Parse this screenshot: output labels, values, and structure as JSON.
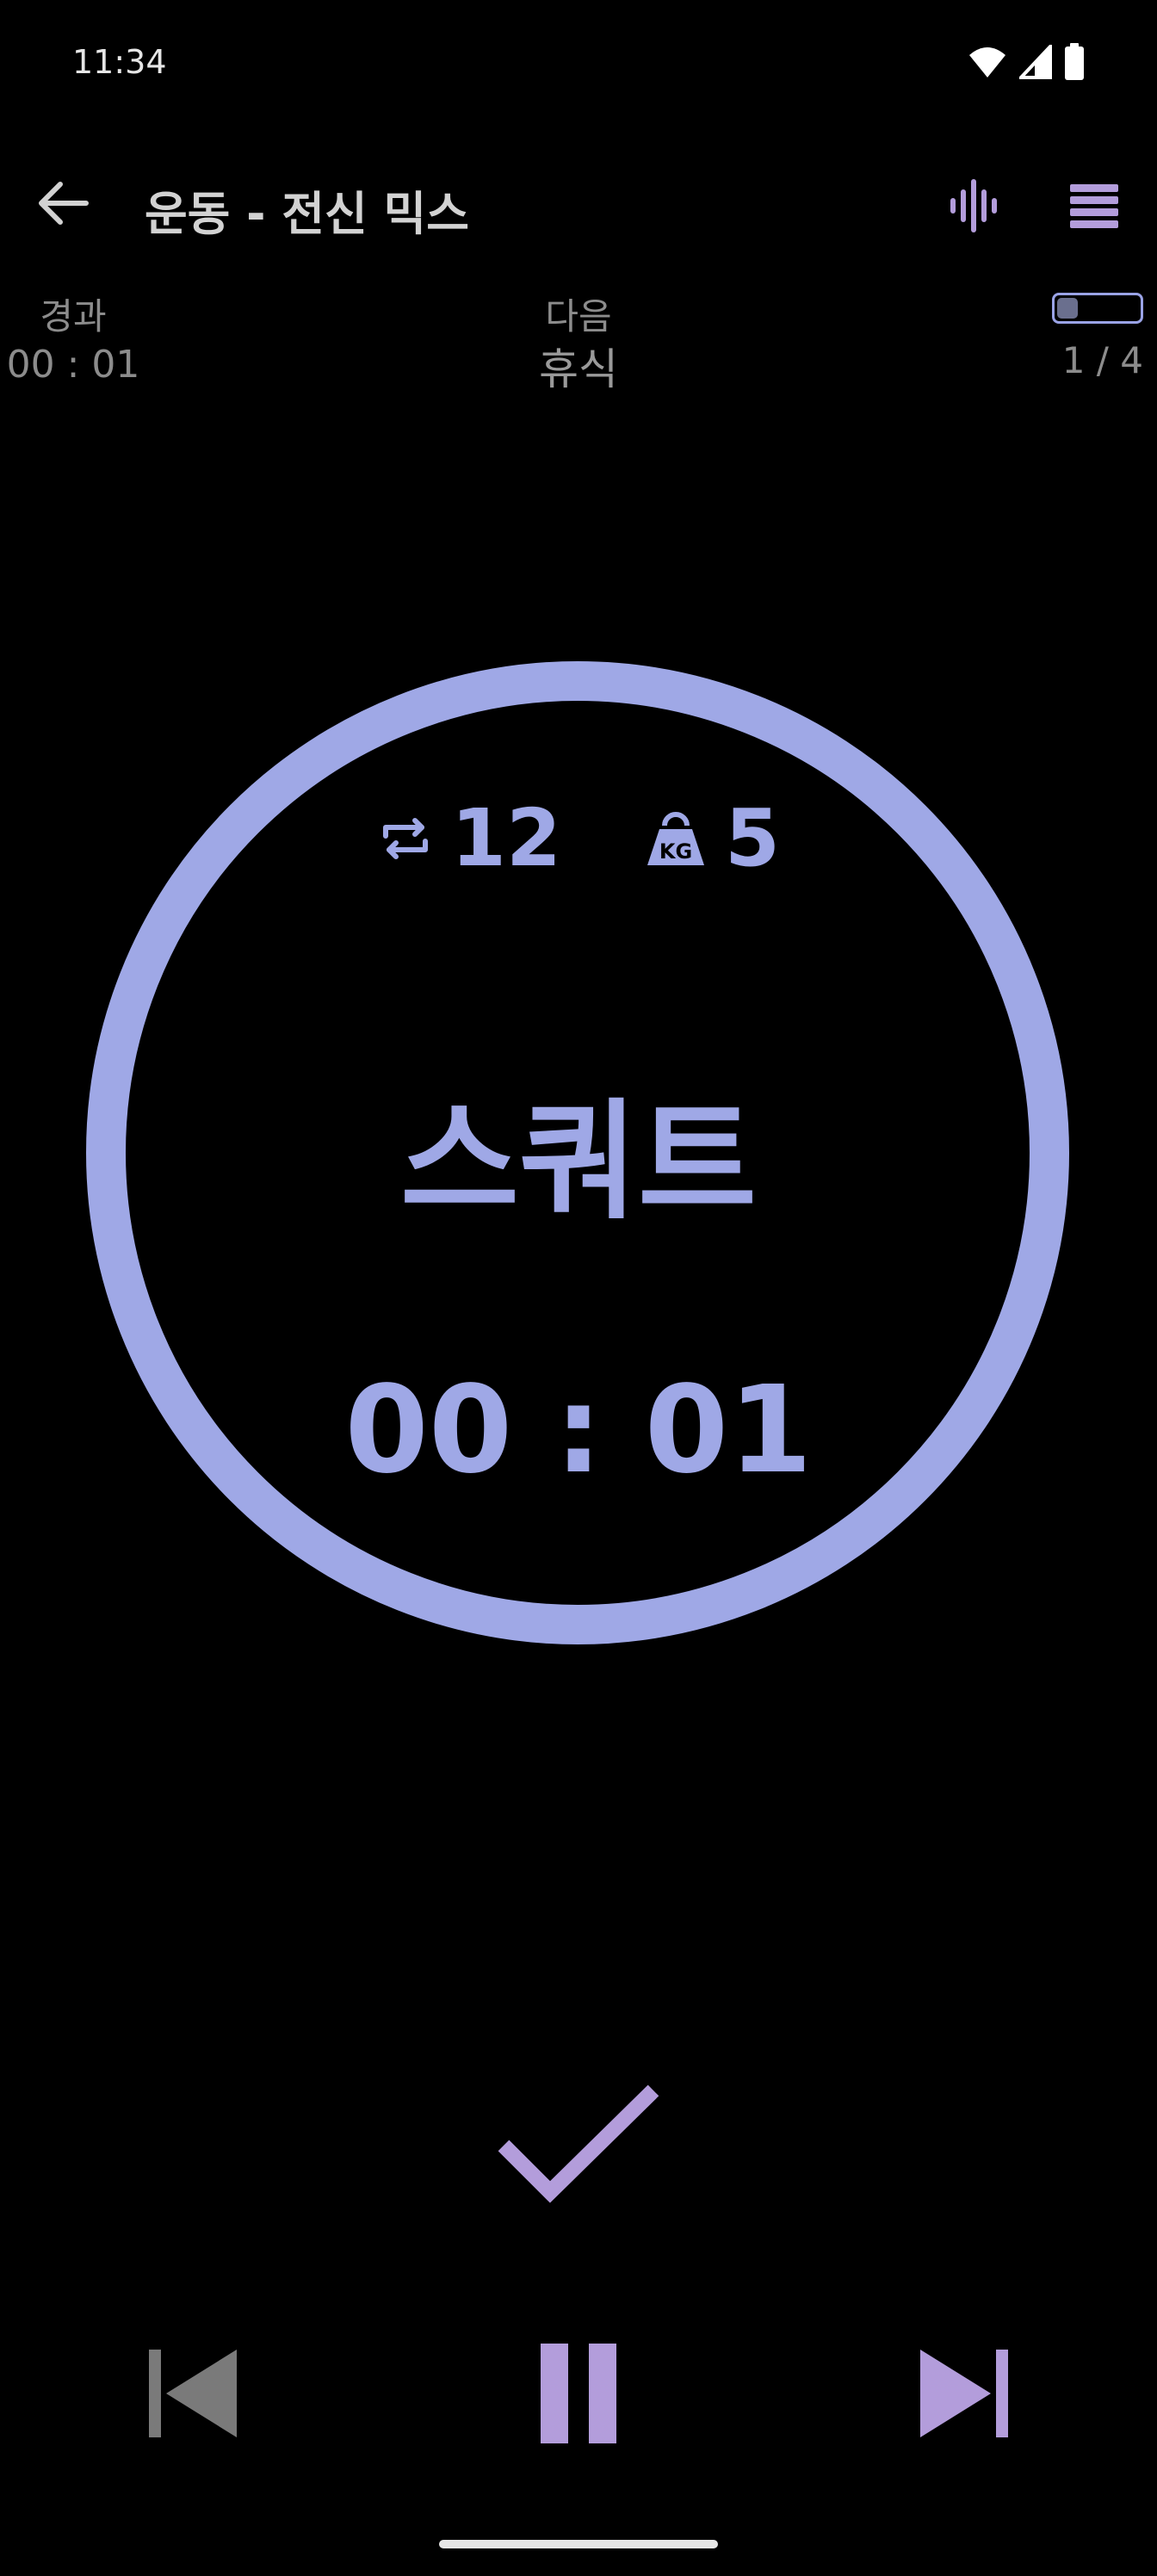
{
  "status_bar": {
    "time": "11:34",
    "icons": [
      "wifi-icon",
      "signal-icon",
      "battery-icon"
    ]
  },
  "app_bar": {
    "title": "운동 - 전신 믹스",
    "icons": [
      "back-arrow-icon",
      "waveform-icon",
      "menu-icon"
    ]
  },
  "info": {
    "elapsed_label": "경과",
    "elapsed_value": "00 : 01",
    "next_label": "다음",
    "next_value": "휴식",
    "progress_text": "1 / 4",
    "progress_fraction": 0.25
  },
  "exercise": {
    "reps": "12",
    "weight": "5",
    "name": "스쿼트",
    "timer": "00 : 01"
  },
  "colors": {
    "accent": "#9fa8e6",
    "accent_purple": "#b39ddb",
    "muted": "#8c8c8c",
    "background": "#000000"
  },
  "controls": {
    "icons": [
      "skip-previous-icon",
      "pause-icon",
      "skip-next-icon",
      "check-icon"
    ]
  }
}
